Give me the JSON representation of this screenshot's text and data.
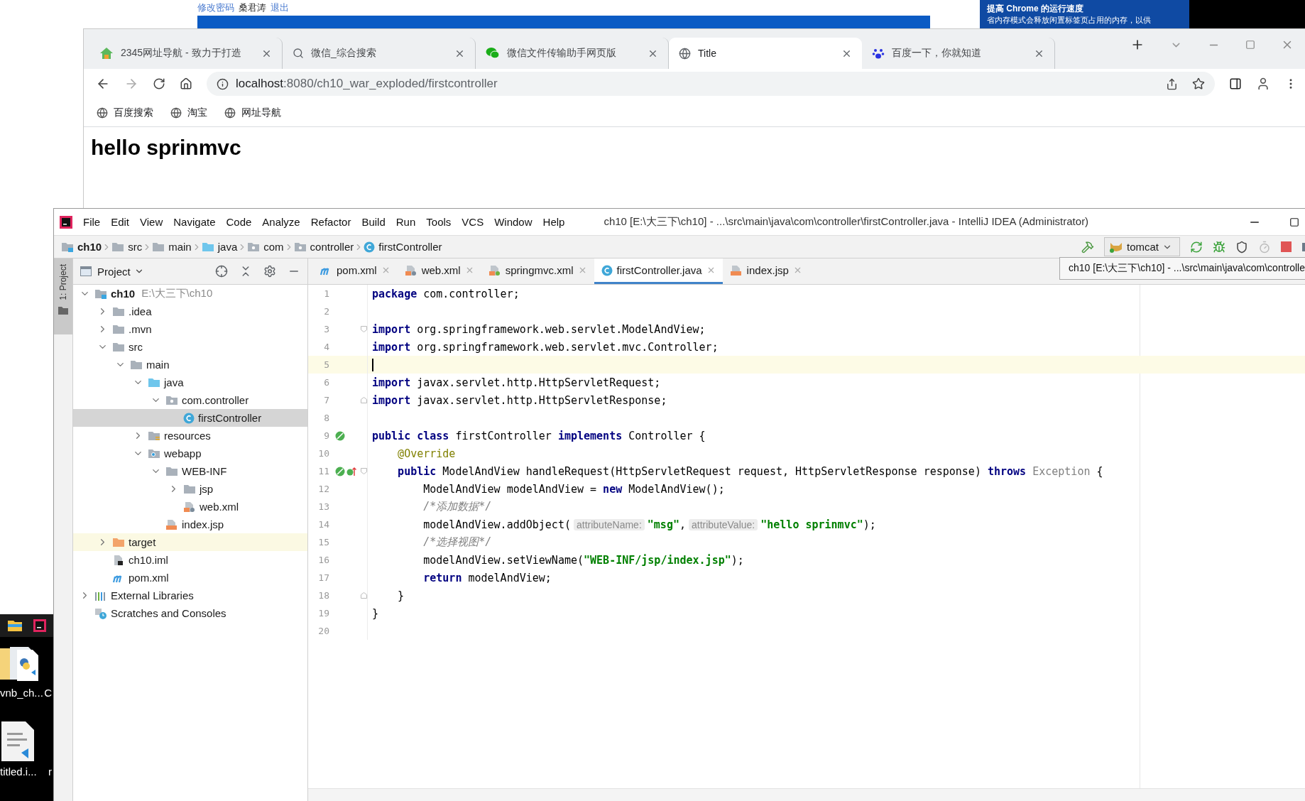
{
  "background_page": {
    "links": [
      "修改密码",
      "桑君涛",
      "退出"
    ],
    "notice": {
      "title": "提高 Chrome 的运行速度",
      "text": "省内存模式会释放闲置标签页占用的内存，以供"
    }
  },
  "browser": {
    "tabs": [
      {
        "title": "2345网址导航 - 致力于打造",
        "kind": "nav",
        "selected": false
      },
      {
        "title": "微信_综合搜索",
        "kind": "search",
        "selected": false
      },
      {
        "title": "微信文件传输助手网页版",
        "kind": "chat",
        "selected": false
      },
      {
        "title": "Title",
        "kind": "page",
        "selected": true
      },
      {
        "title": "百度一下，你就知道",
        "kind": "paw",
        "selected": false
      }
    ],
    "address": {
      "host": "localhost",
      "path": ":8080/ch10_war_exploded/firstcontroller"
    },
    "bookmarks": [
      "百度搜索",
      "淘宝",
      "网址导航"
    ],
    "page": {
      "heading": "hello sprinmvc"
    }
  },
  "desktop": {
    "icons": [
      {
        "kind": "folder",
        "label": "vnb_ch...",
        "neighbor_label": "C"
      },
      {
        "kind": "document",
        "label": "titled.i...",
        "neighbor_label": "r"
      }
    ]
  },
  "ide": {
    "title": "ch10 [E:\\大三下\\ch10] - ...\\src\\main\\java\\com\\controller\\firstController.java - IntelliJ IDEA (Administrator)",
    "menu": [
      "File",
      "Edit",
      "View",
      "Navigate",
      "Code",
      "Analyze",
      "Refactor",
      "Build",
      "Run",
      "Tools",
      "VCS",
      "Window",
      "Help"
    ],
    "breadcrumbs": [
      {
        "label": "ch10",
        "kind": "module"
      },
      {
        "label": "src",
        "kind": "folder"
      },
      {
        "label": "main",
        "kind": "folder"
      },
      {
        "label": "java",
        "kind": "source"
      },
      {
        "label": "com",
        "kind": "package"
      },
      {
        "label": "controller",
        "kind": "package"
      },
      {
        "label": "firstController",
        "kind": "class"
      }
    ],
    "run_config": "tomcat",
    "tool_stripe": "1: Project",
    "project": {
      "title": "Project",
      "tree": [
        {
          "label": "ch10",
          "note": "E:\\大三下\\ch10",
          "kind": "module",
          "expanded": true,
          "selected": false,
          "children": [
            {
              "label": ".idea",
              "kind": "folder",
              "expanded": false,
              "selected": false
            },
            {
              "label": ".mvn",
              "kind": "folder",
              "expanded": false,
              "selected": false
            },
            {
              "label": "src",
              "kind": "folder",
              "expanded": true,
              "selected": false,
              "children": [
                {
                  "label": "main",
                  "kind": "folder",
                  "expanded": true,
                  "selected": false,
                  "children": [
                    {
                      "label": "java",
                      "kind": "source",
                      "expanded": true,
                      "selected": false,
                      "children": [
                        {
                          "label": "com.controller",
                          "kind": "package",
                          "expanded": true,
                          "selected": false,
                          "children": [
                            {
                              "label": "firstController",
                              "kind": "class",
                              "selected": true
                            }
                          ]
                        }
                      ]
                    },
                    {
                      "label": "resources",
                      "kind": "resources",
                      "expanded": false,
                      "selected": false
                    },
                    {
                      "label": "webapp",
                      "kind": "web",
                      "expanded": true,
                      "selected": false,
                      "children": [
                        {
                          "label": "WEB-INF",
                          "kind": "folder",
                          "expanded": true,
                          "selected": false,
                          "children": [
                            {
                              "label": "jsp",
                              "kind": "folder",
                              "expanded": false,
                              "selected": false
                            },
                            {
                              "label": "web.xml",
                              "kind": "xml",
                              "selected": false
                            }
                          ]
                        },
                        {
                          "label": "index.jsp",
                          "kind": "jsp",
                          "selected": false
                        }
                      ]
                    }
                  ]
                }
              ]
            },
            {
              "label": "target",
              "kind": "excluded",
              "expanded": false,
              "selected": false
            },
            {
              "label": "ch10.iml",
              "kind": "iml",
              "selected": false
            },
            {
              "label": "pom.xml",
              "kind": "maven",
              "selected": false
            }
          ]
        },
        {
          "label": "External Libraries",
          "kind": "libraries",
          "expanded": false,
          "selected": false
        },
        {
          "label": "Scratches and Consoles",
          "kind": "scratches",
          "selected": false
        }
      ]
    },
    "editor_tabs": [
      {
        "label": "pom.xml",
        "kind": "maven",
        "selected": false
      },
      {
        "label": "web.xml",
        "kind": "xml",
        "selected": false
      },
      {
        "label": "springmvc.xml",
        "kind": "spring",
        "selected": false
      },
      {
        "label": "firstController.java",
        "kind": "class",
        "selected": true
      },
      {
        "label": "index.jsp",
        "kind": "jsp",
        "selected": false
      }
    ],
    "tooltip": "ch10 [E:\\大三下\\ch10] - ...\\src\\main\\java\\com\\controlle",
    "editor": {
      "lines": [
        {
          "number": "1",
          "current": false,
          "tokens": [
            {
              "kind": "kw",
              "text": "package"
            },
            {
              "kind": "p",
              "text": " com.controller;"
            }
          ]
        },
        {
          "number": "2",
          "current": false
        },
        {
          "number": "3",
          "current": false,
          "markers": [
            {
              "kind": "fold-start"
            }
          ],
          "tokens": [
            {
              "kind": "kw",
              "text": "import"
            },
            {
              "kind": "p",
              "text": " org.springframework.web.servlet.ModelAndView;"
            }
          ]
        },
        {
          "number": "4",
          "current": false,
          "tokens": [
            {
              "kind": "kw",
              "text": "import"
            },
            {
              "kind": "p",
              "text": " org.springframework.web.servlet.mvc.Controller;"
            }
          ]
        },
        {
          "number": "5",
          "current": true
        },
        {
          "number": "6",
          "current": false,
          "tokens": [
            {
              "kind": "kw",
              "text": "import"
            },
            {
              "kind": "p",
              "text": " javax.servlet.http.HttpServletRequest;"
            }
          ]
        },
        {
          "number": "7",
          "current": false,
          "markers": [
            {
              "kind": "fold-end"
            }
          ],
          "tokens": [
            {
              "kind": "kw",
              "text": "import"
            },
            {
              "kind": "p",
              "text": " javax.servlet.http.HttpServletResponse;"
            }
          ]
        },
        {
          "number": "8",
          "current": false
        },
        {
          "number": "9",
          "current": false,
          "markers": [
            {
              "kind": "implemented"
            }
          ],
          "tokens": [
            {
              "kind": "kw",
              "text": "public class"
            },
            {
              "kind": "p",
              "text": " firstController "
            },
            {
              "kind": "kw",
              "text": "implements"
            },
            {
              "kind": "p",
              "text": " Controller {"
            }
          ]
        },
        {
          "number": "10",
          "current": false,
          "tokens": [
            {
              "kind": "an",
              "text": "    @Override"
            }
          ]
        },
        {
          "number": "11",
          "current": false,
          "markers": [
            {
              "kind": "implemented"
            },
            {
              "kind": "overriding"
            },
            {
              "kind": "fold-start"
            }
          ],
          "tokens": [
            {
              "kind": "kw",
              "text": "    public"
            },
            {
              "kind": "p",
              "text": " ModelAndView handleRequest(HttpServletRequest request, HttpServletResponse response) "
            },
            {
              "kind": "kw",
              "text": "throws"
            },
            {
              "kind": "mu",
              "text": " Exception"
            },
            {
              "kind": "p",
              "text": " {"
            }
          ]
        },
        {
          "number": "12",
          "current": false,
          "tokens": [
            {
              "kind": "p",
              "text": "        ModelAndView modelAndView = "
            },
            {
              "kind": "kw",
              "text": "new"
            },
            {
              "kind": "p",
              "text": " ModelAndView();"
            }
          ]
        },
        {
          "number": "13",
          "current": false,
          "tokens": [
            {
              "kind": "cm",
              "text": "        /*添加数据*/"
            }
          ]
        },
        {
          "number": "14",
          "current": false,
          "tokens": [
            {
              "kind": "p",
              "text": "        modelAndView.addObject("
            },
            {
              "kind": "hint",
              "text": "attributeName:"
            },
            {
              "kind": "str",
              "text": "\"msg\""
            },
            {
              "kind": "p",
              "text": ","
            },
            {
              "kind": "hint",
              "text": "attributeValue:"
            },
            {
              "kind": "str",
              "text": "\"hello sprinmvc\""
            },
            {
              "kind": "p",
              "text": ");"
            }
          ]
        },
        {
          "number": "15",
          "current": false,
          "tokens": [
            {
              "kind": "cm",
              "text": "        /*选择视图*/"
            }
          ]
        },
        {
          "number": "16",
          "current": false,
          "tokens": [
            {
              "kind": "p",
              "text": "        modelAndView.setViewName("
            },
            {
              "kind": "str",
              "text": "\"WEB-INF/jsp/index.jsp\""
            },
            {
              "kind": "p",
              "text": ");"
            }
          ]
        },
        {
          "number": "17",
          "current": false,
          "tokens": [
            {
              "kind": "kw",
              "text": "        return"
            },
            {
              "kind": "p",
              "text": " modelAndView;"
            }
          ]
        },
        {
          "number": "18",
          "current": false,
          "markers": [
            {
              "kind": "fold-end"
            }
          ],
          "tokens": [
            {
              "kind": "p",
              "text": "    }"
            }
          ]
        },
        {
          "number": "19",
          "current": false,
          "tokens": [
            {
              "kind": "p",
              "text": "}"
            }
          ]
        },
        {
          "number": "20",
          "current": false
        }
      ]
    }
  }
}
